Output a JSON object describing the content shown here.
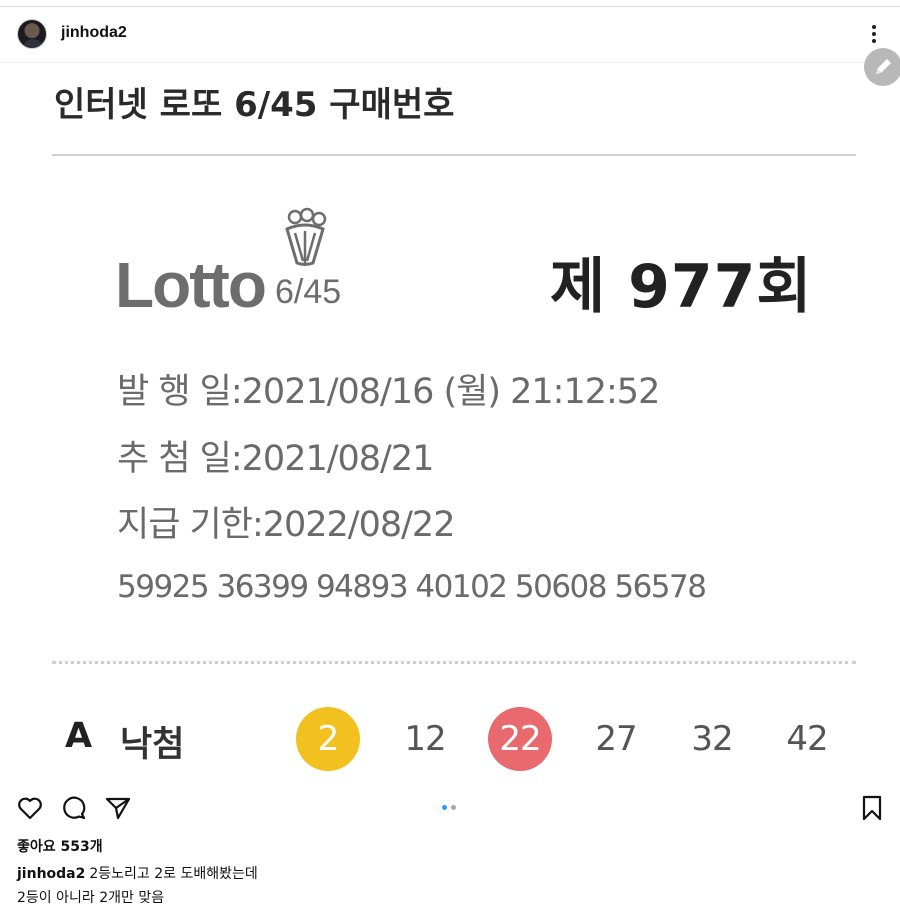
{
  "header": {
    "username": "jinhoda2",
    "more_icon": "more-vertical-icon",
    "edit_icon": "pencil-icon"
  },
  "ticket": {
    "title": "인터넷 로또 6/45 구매번호",
    "logo_word": "Lotto",
    "logo_sub": "6/45",
    "round": "제 977회",
    "issue_key": "발 행 일",
    "issue_value": ":2021/08/16 (월) 21:12:52",
    "draw_key": "추 첨 일",
    "draw_value": ":2021/08/21",
    "deadline_key": "지급 기한",
    "deadline_value": ":2022/08/22",
    "numbers_line": "59925 36399 94893 40102 50608 56578",
    "game": {
      "label": "A",
      "status": "낙첨",
      "balls": [
        {
          "number": "2",
          "matched": true,
          "color": "#f2c11f"
        },
        {
          "number": "12",
          "matched": false,
          "color": ""
        },
        {
          "number": "22",
          "matched": true,
          "color": "#e86a6f"
        },
        {
          "number": "27",
          "matched": false,
          "color": ""
        },
        {
          "number": "32",
          "matched": false,
          "color": ""
        },
        {
          "number": "42",
          "matched": false,
          "color": ""
        }
      ]
    }
  },
  "actions": {
    "like_icon": "heart-icon",
    "comment_icon": "comment-icon",
    "share_icon": "send-icon",
    "save_icon": "bookmark-icon",
    "carousel": {
      "pages": 2,
      "active": 1,
      "active_color": "#3897f0",
      "inactive_color": "#a8a8a8"
    }
  },
  "likes": "좋아요 553개",
  "caption": {
    "user": "jinhoda2",
    "line1": "2등노리고 2로 도배해봤는데",
    "line2": "2등이 아니라 2개만 맞음"
  }
}
